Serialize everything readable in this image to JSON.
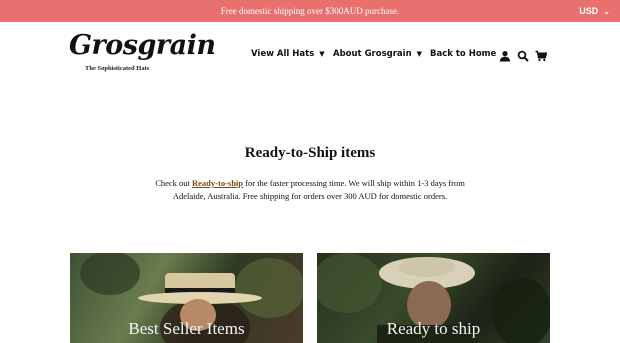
{
  "announcement": "Free domestic shipping over $300AUD purchase.",
  "currency": "USD",
  "logo": {
    "wordmark": "Grosgrain",
    "tagline": "The Sophisticated Hats"
  },
  "nav": [
    {
      "label": "View All Hats",
      "dropdown": true
    },
    {
      "label": "About Grosgrain",
      "dropdown": true
    },
    {
      "label": "Back to Home",
      "dropdown": false
    }
  ],
  "header_icons": [
    "user-icon",
    "search-icon",
    "cart-icon"
  ],
  "page": {
    "title": "Ready-to-Ship items",
    "body_prefix": "Check out ",
    "body_link": "Ready-to-ship",
    "body_suffix": " for the faster processing time. We will ship within 1-3 days from Adelaide, Australia. Free shipping for orders over 300 AUD for domestic orders."
  },
  "collections": [
    {
      "label": "Best Seller Items"
    },
    {
      "label": "Ready to ship"
    }
  ],
  "colors": {
    "announcement_bg": "#e8716f",
    "link": "#7a4a1a"
  }
}
